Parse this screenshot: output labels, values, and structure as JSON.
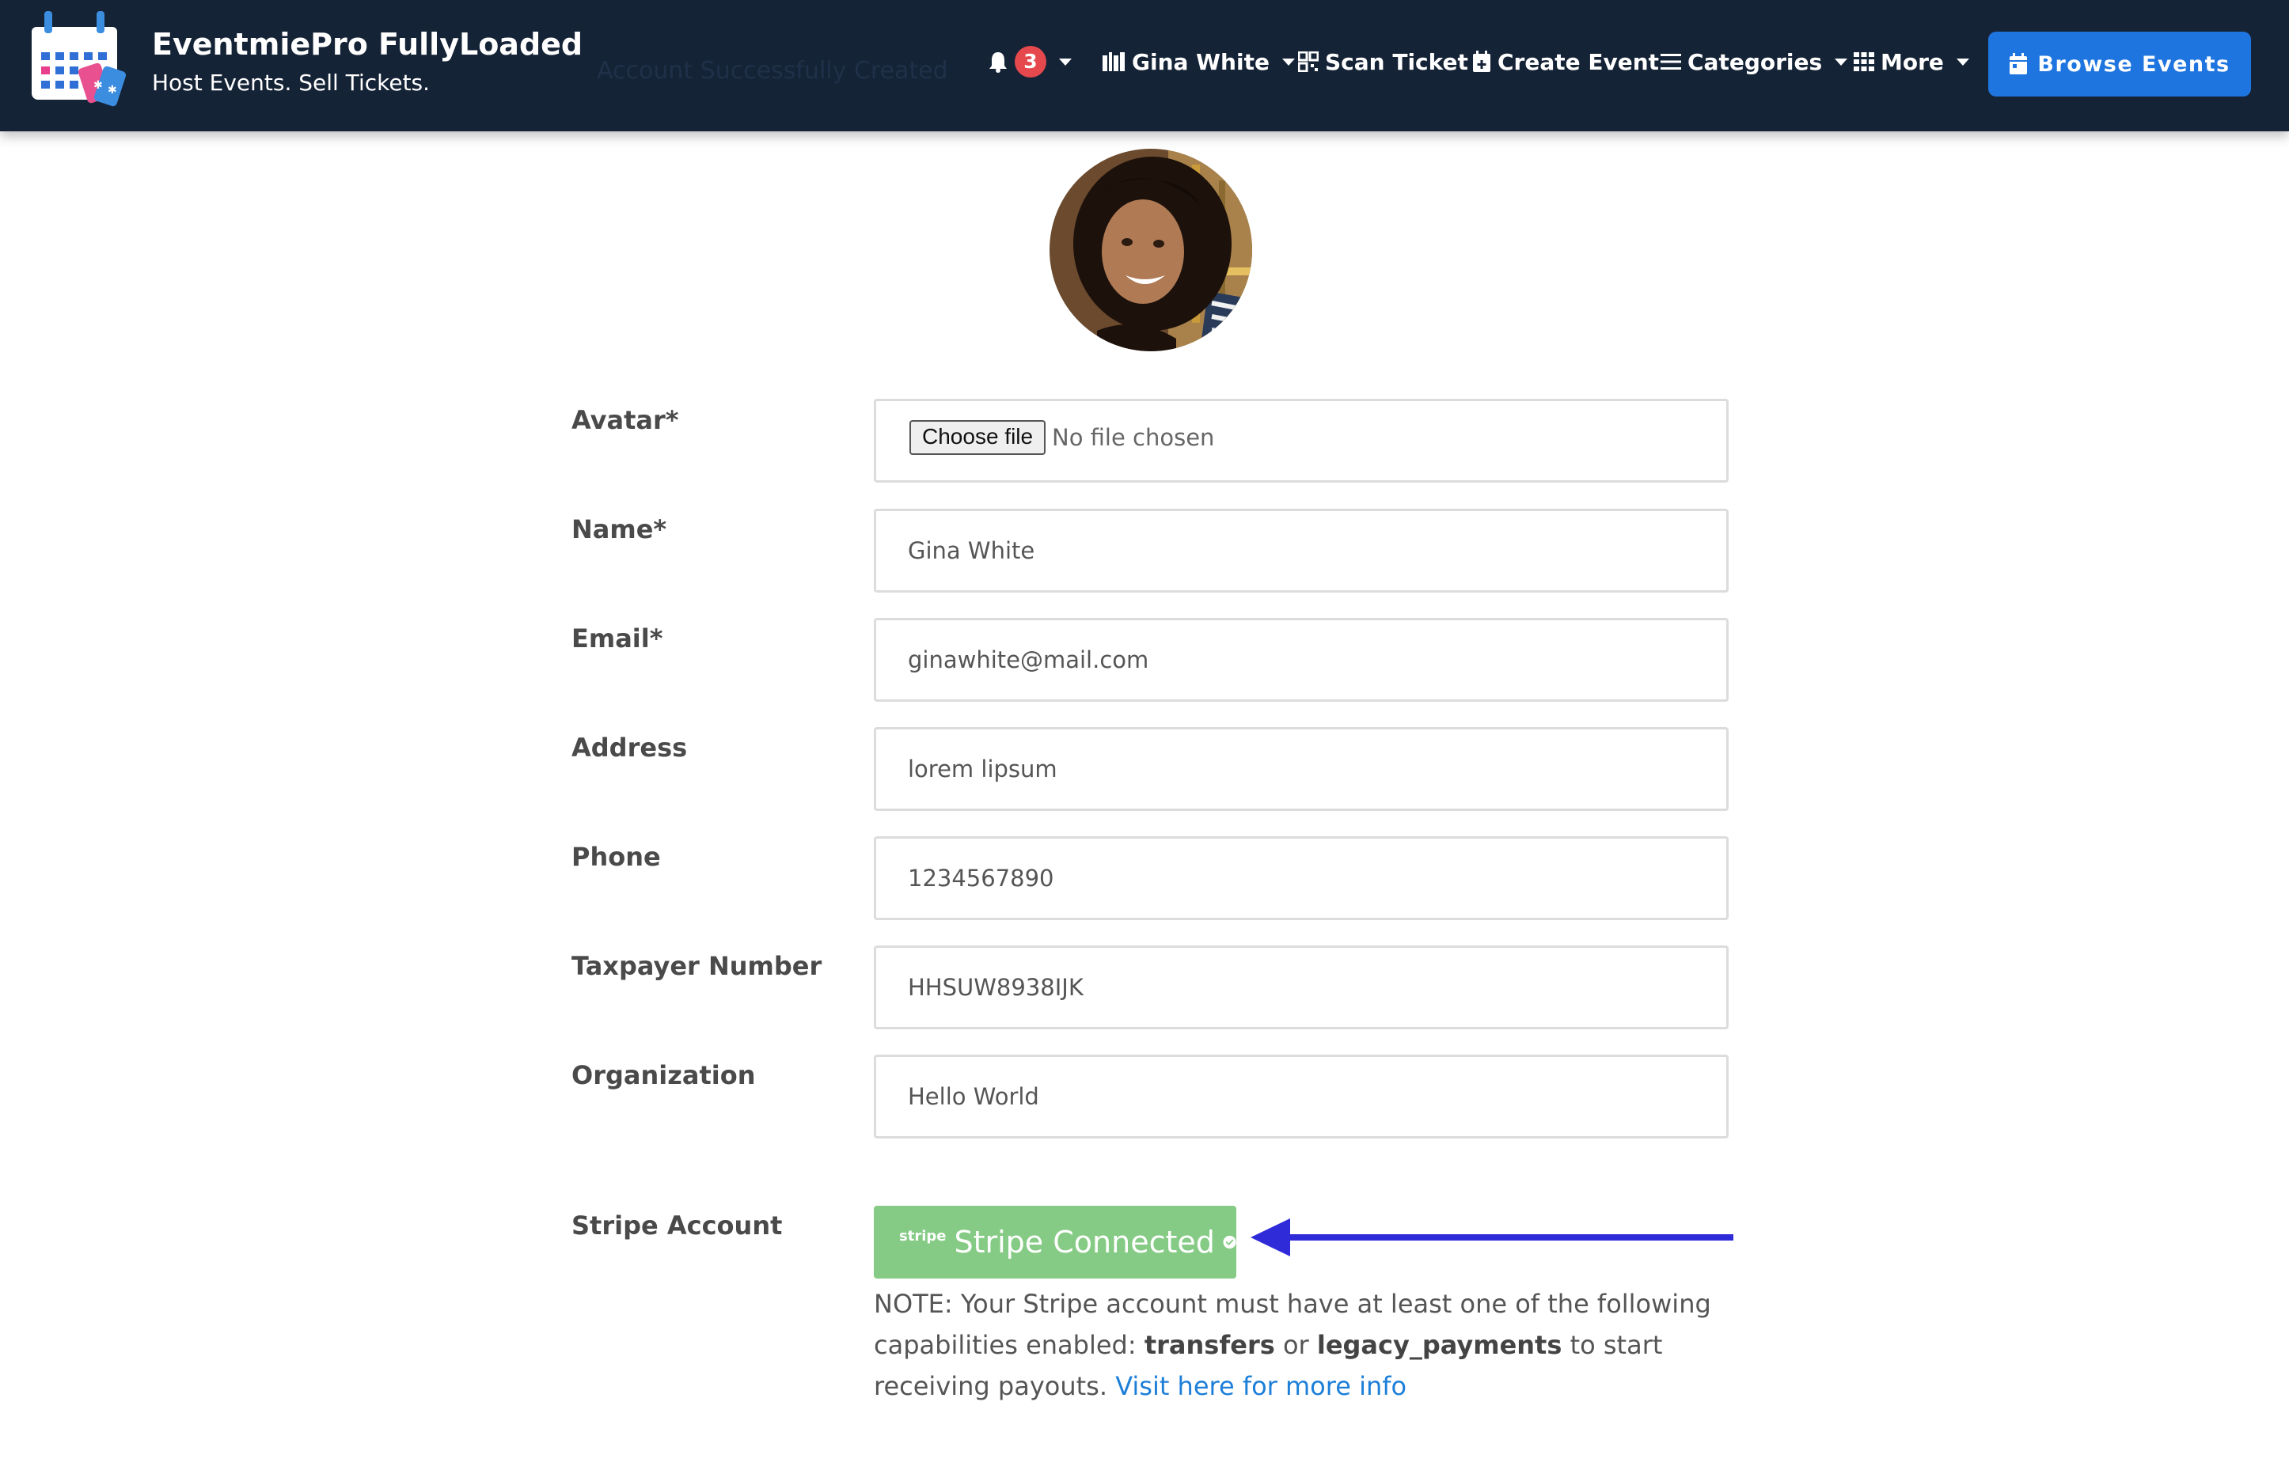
{
  "brand": {
    "title": "EventmiePro FullyLoaded",
    "tagline": "Host Events. Sell Tickets."
  },
  "banner": {
    "ghost_text": "Account Successfully Created"
  },
  "nav": {
    "notifications": {
      "count": "3",
      "icon": "bell-icon"
    },
    "user": {
      "label": "Gina White",
      "icon": "user-icon"
    },
    "scan_ticket": {
      "label": "Scan Ticket",
      "icon": "qrcode-icon"
    },
    "create_event": {
      "label": "Create Event",
      "icon": "calendar-plus-icon"
    },
    "categories": {
      "label": "Categories",
      "icon": "bars-icon"
    },
    "more": {
      "label": "More",
      "icon": "grid-icon"
    },
    "browse_events": {
      "label": "Browse Events",
      "icon": "calendar-icon"
    }
  },
  "form": {
    "avatar": {
      "label": "Avatar*",
      "button": "Choose file",
      "status": "No file chosen"
    },
    "name": {
      "label": "Name*",
      "value": "Gina White"
    },
    "email": {
      "label": "Email*",
      "value": "ginawhite@mail.com"
    },
    "address": {
      "label": "Address",
      "value": "lorem lipsum"
    },
    "phone": {
      "label": "Phone",
      "value": "1234567890"
    },
    "taxpayer": {
      "label": "Taxpayer Number",
      "value": "HHSUW8938IJK"
    },
    "organization": {
      "label": "Organization",
      "value": "Hello World"
    },
    "stripe": {
      "label": "Stripe Account",
      "badge_small": "stripe",
      "button": "Stripe Connected",
      "note_prefix": "NOTE: Your Stripe account must have at least one of the following capabilities enabled: ",
      "cap1": "transfers",
      "or": " or ",
      "cap2": "legacy_payments",
      "note_suffix": " to start receiving payouts. ",
      "link": "Visit here for more info"
    }
  },
  "colors": {
    "navbar": "#152336",
    "primary": "#1f75df",
    "success": "#85cb85",
    "badge": "#e5484d",
    "annotation_arrow": "#2f2bd9",
    "link": "#1d7fd8"
  }
}
